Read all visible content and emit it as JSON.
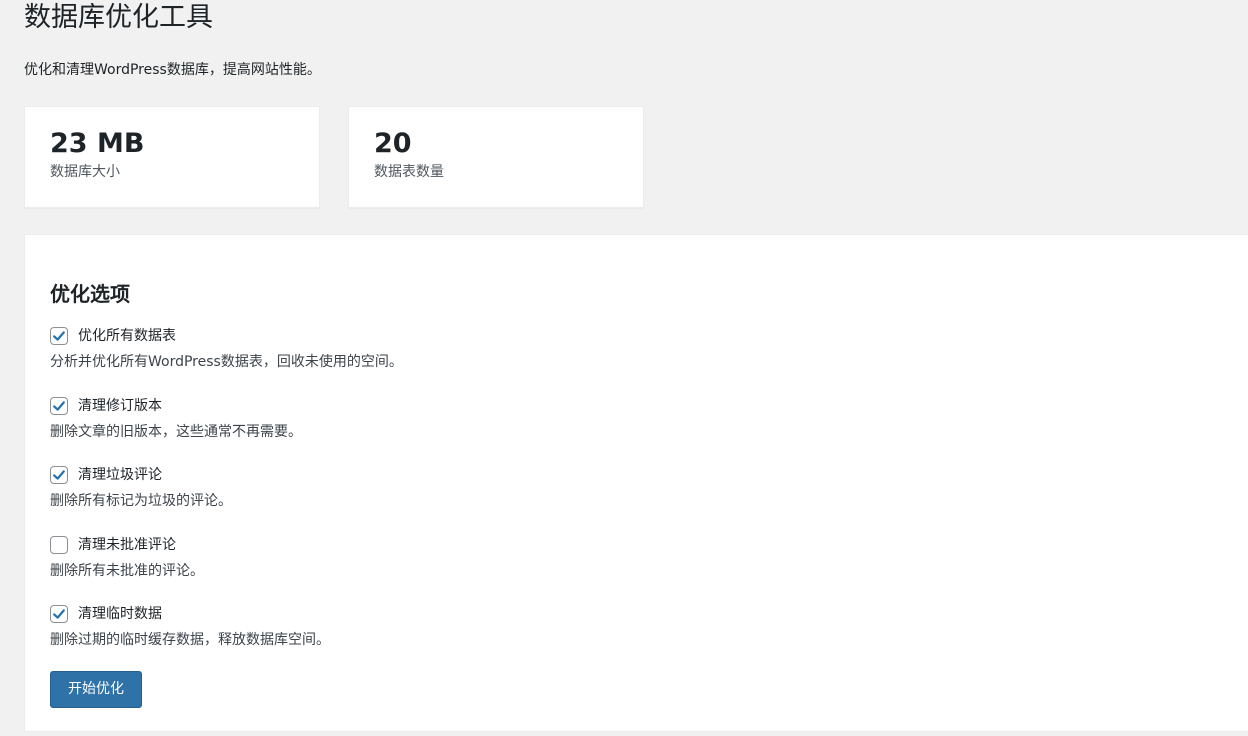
{
  "header": {
    "title": "数据库优化工具",
    "description": "优化和清理WordPress数据库，提高网站性能。"
  },
  "stats": [
    {
      "value": "23 MB",
      "label": "数据库大小"
    },
    {
      "value": "20",
      "label": "数据表数量"
    }
  ],
  "panel": {
    "title": "优化选项",
    "options": [
      {
        "label": "优化所有数据表",
        "description": "分析并优化所有WordPress数据表，回收未使用的空间。",
        "checked": true
      },
      {
        "label": "清理修订版本",
        "description": "删除文章的旧版本，这些通常不再需要。",
        "checked": true
      },
      {
        "label": "清理垃圾评论",
        "description": "删除所有标记为垃圾的评论。",
        "checked": true
      },
      {
        "label": "清理未批准评论",
        "description": "删除所有未批准的评论。",
        "checked": false
      },
      {
        "label": "清理临时数据",
        "description": "删除过期的临时缓存数据，释放数据库空间。",
        "checked": true
      }
    ],
    "button_label": "开始优化"
  },
  "colors": {
    "accent": "#2f72a8",
    "checkmark": "#2271b1",
    "background": "#f1f1f1"
  }
}
